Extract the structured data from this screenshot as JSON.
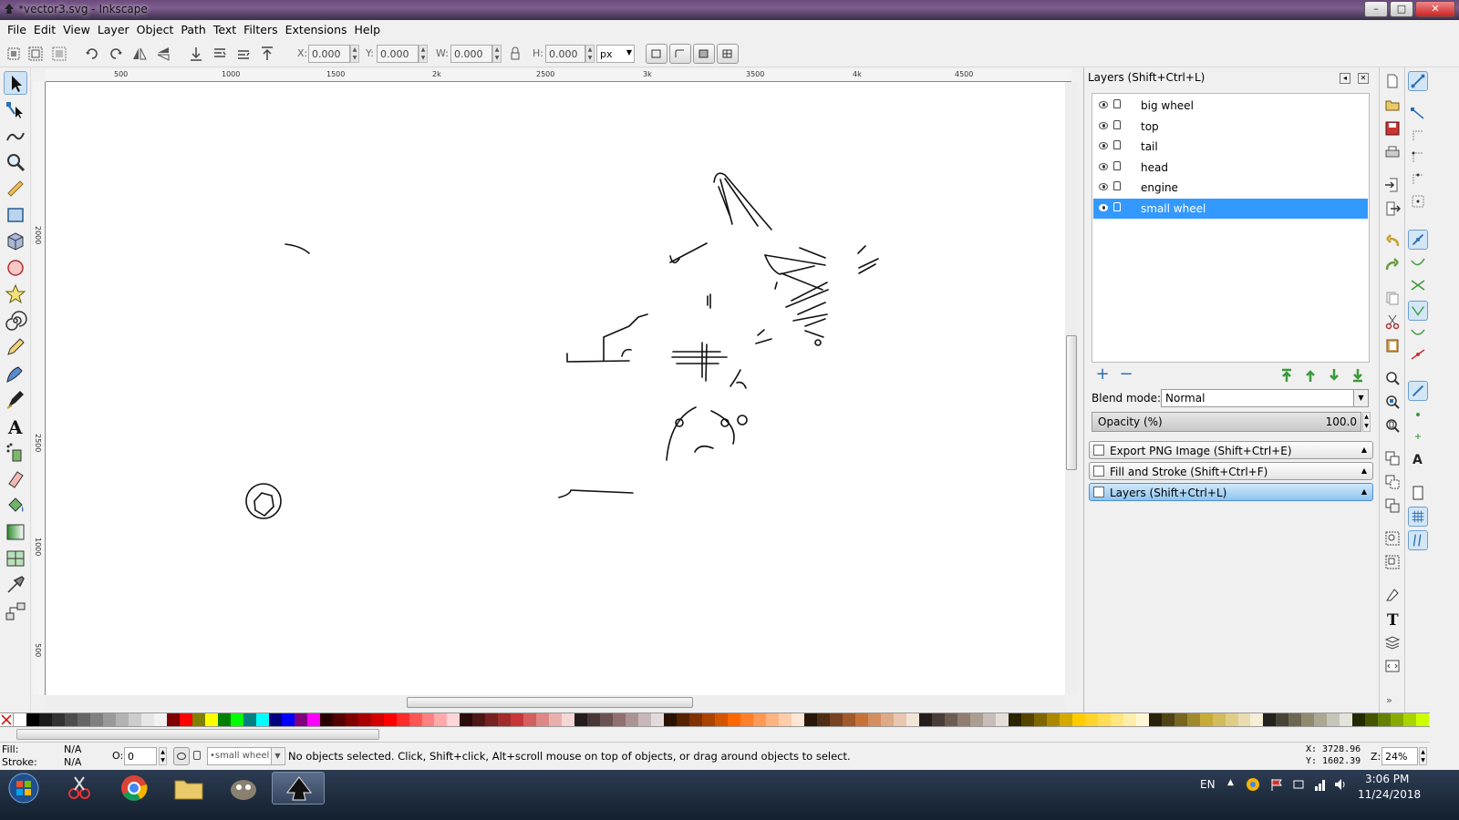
{
  "window": {
    "title": "*vector3.svg - Inkscape",
    "min": "–",
    "max": "□",
    "close": "✕"
  },
  "menu": [
    "File",
    "Edit",
    "View",
    "Layer",
    "Object",
    "Path",
    "Text",
    "Filters",
    "Extensions",
    "Help"
  ],
  "toolbar": {
    "x_label": "X:",
    "x_value": "0.000",
    "y_label": "Y:",
    "y_value": "0.000",
    "w_label": "W:",
    "w_value": "0.000",
    "h_label": "H:",
    "h_value": "0.000",
    "unit": "px"
  },
  "ruler_top": [
    "500",
    "1000",
    "1500",
    "2k",
    "2500",
    "3k",
    "3500",
    "4k",
    "4500"
  ],
  "ruler_left": [
    "2000",
    "2500",
    "1000",
    "500"
  ],
  "dock": {
    "title": "Layers (Shift+Ctrl+L)",
    "layers": [
      {
        "name": "big wheel",
        "selected": false
      },
      {
        "name": "top",
        "selected": false
      },
      {
        "name": "tail",
        "selected": false
      },
      {
        "name": "head",
        "selected": false
      },
      {
        "name": "engine",
        "selected": false
      },
      {
        "name": "small wheel",
        "selected": true
      }
    ],
    "blend_label": "Blend mode:",
    "blend_value": "Normal",
    "opacity_label": "Opacity (%)",
    "opacity_value": "100.0",
    "dialogs": [
      {
        "label": "Export PNG Image (Shift+Ctrl+E)",
        "active": false
      },
      {
        "label": "Fill and Stroke (Shift+Ctrl+F)",
        "active": false
      },
      {
        "label": "Layers (Shift+Ctrl+L)",
        "active": true
      }
    ]
  },
  "palette": [
    "#ffffff",
    "#000000",
    "#1a1a1a",
    "#333333",
    "#4d4d4d",
    "#666666",
    "#808080",
    "#999999",
    "#b3b3b3",
    "#cccccc",
    "#e6e6e6",
    "#f2f2f2",
    "#800000",
    "#ff0000",
    "#808000",
    "#ffff00",
    "#008000",
    "#00ff00",
    "#008080",
    "#00ffff",
    "#000080",
    "#0000ff",
    "#800080",
    "#ff00ff",
    "#2b0000",
    "#550000",
    "#800000",
    "#aa0000",
    "#d40000",
    "#ff0000",
    "#ff2a2a",
    "#ff5555",
    "#ff8080",
    "#ffaaaa",
    "#ffd5d5",
    "#280b0b",
    "#501616",
    "#782121",
    "#a02c2c",
    "#c83737",
    "#d35f5f",
    "#de8787",
    "#e9afaf",
    "#f4d7d7",
    "#241c1c",
    "#483737",
    "#6c5353",
    "#916f6f",
    "#ac9393",
    "#c8b7b7",
    "#e3dbdb",
    "#2b1100",
    "#552200",
    "#803300",
    "#aa4400",
    "#d45500",
    "#ff6600",
    "#ff7f2a",
    "#ff9955",
    "#ffb380",
    "#ffccaa",
    "#ffe6d5",
    "#28170b",
    "#502d16",
    "#784421",
    "#a05a2c",
    "#c87137",
    "#d38d5f",
    "#deaa87",
    "#e9c6af",
    "#f4e3d7",
    "#241f1c",
    "#483e37",
    "#6c5d53",
    "#917c6f",
    "#ac9d93",
    "#c8beb7",
    "#e3dedb",
    "#2b2200",
    "#554400",
    "#806600",
    "#aa8800",
    "#d4aa00",
    "#ffcc00",
    "#ffd42a",
    "#ffdd55",
    "#ffe680",
    "#ffeeaa",
    "#fff6d5",
    "#28220b",
    "#504416",
    "#786721",
    "#a0892c",
    "#c8ab37",
    "#d3bc5f",
    "#decd87",
    "#e9ddaf",
    "#f4eed7",
    "#24221c",
    "#484537",
    "#6c6753",
    "#918a6f",
    "#aca793",
    "#c8c4b7",
    "#e3e2db",
    "#222b00",
    "#445500",
    "#668000",
    "#88aa00",
    "#aad400",
    "#ccff00"
  ],
  "status": {
    "fill_label": "Fill:",
    "fill_value": "N/A",
    "stroke_label": "Stroke:",
    "stroke_value": "N/A",
    "opacity_label": "O:",
    "opacity_value": "0",
    "layer": "•small wheel",
    "message": "No objects selected. Click, Shift+click, Alt+scroll mouse on top of objects, or drag around objects to select.",
    "cursor_x": "X: 3728.96",
    "cursor_y": "Y: 1602.39",
    "zoom_label": "Z:",
    "zoom_value": "24%"
  },
  "taskbar": {
    "lang": "EN",
    "time": "3:06 PM",
    "date": "11/24/2018"
  }
}
